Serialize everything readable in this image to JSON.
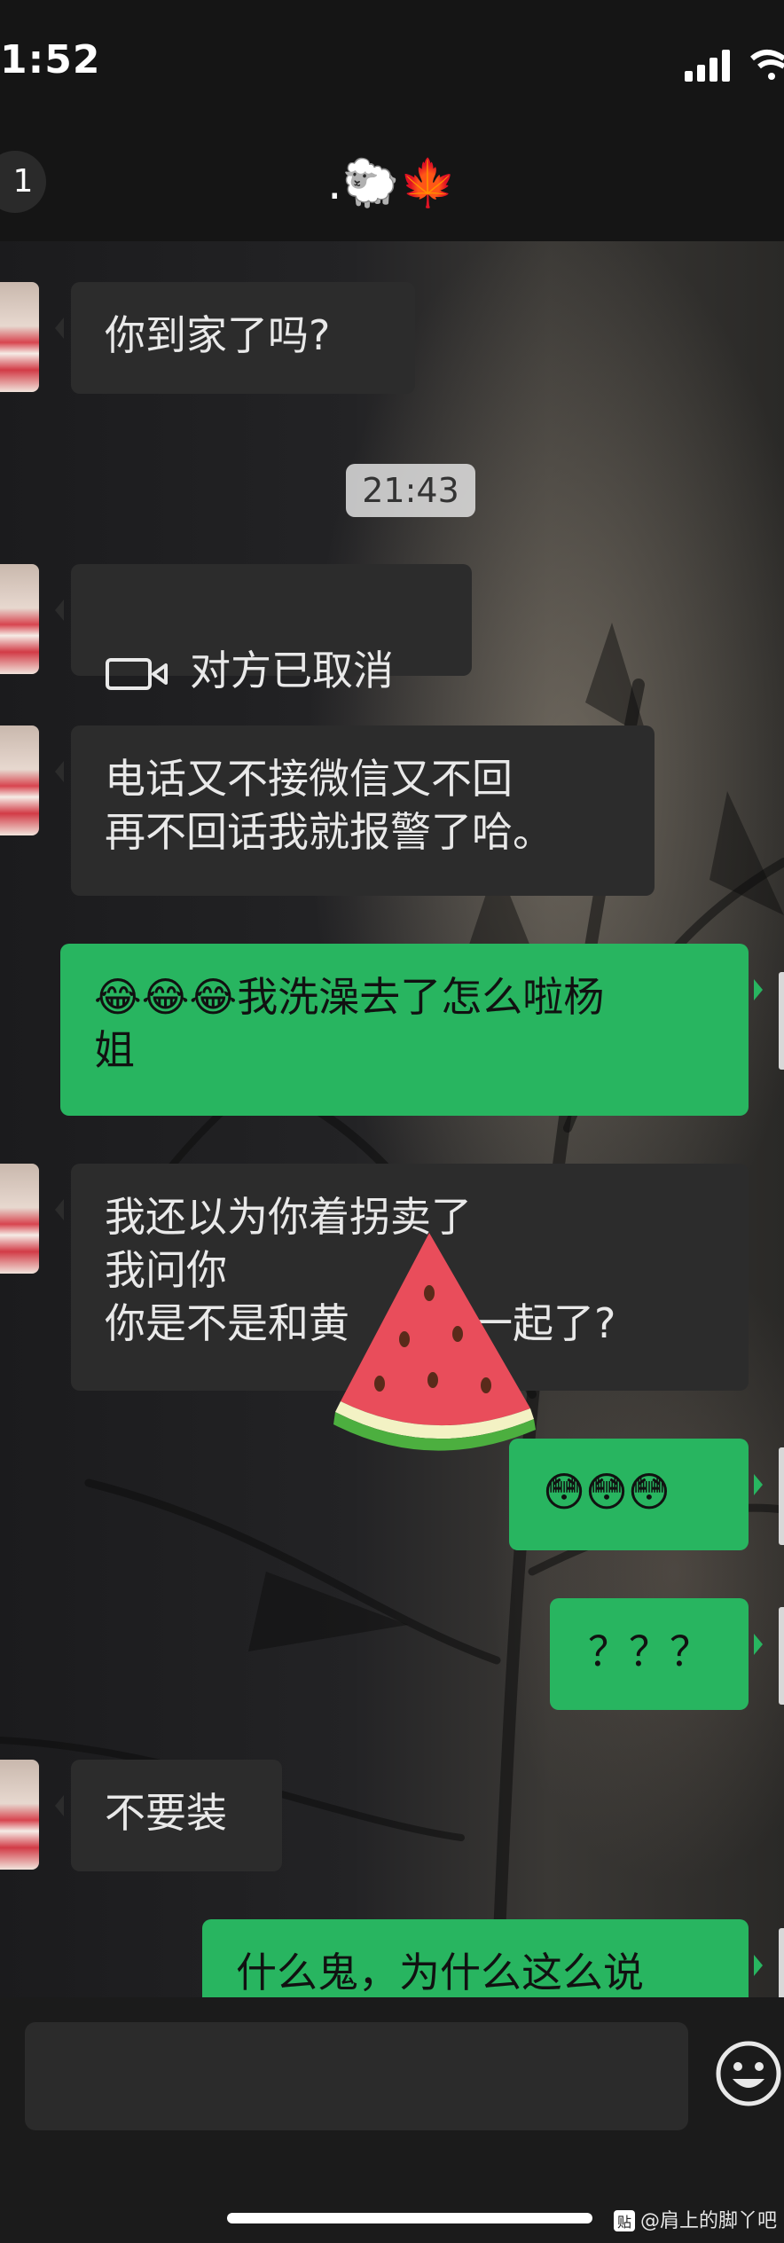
{
  "status_bar": {
    "time": "1:52"
  },
  "nav": {
    "unread_count": "1",
    "title": ".🐑🍁"
  },
  "messages": {
    "m1": {
      "sender": "other",
      "text": "你到家了吗?"
    },
    "timestamp": "21:43",
    "m2": {
      "sender": "other",
      "text": "对方已取消",
      "icon": "video-call-icon"
    },
    "m3": {
      "sender": "other",
      "text": "电话又不接微信又不回\n再不回话我就报警了哈。"
    },
    "m4": {
      "sender": "me",
      "text": "😂😂😂我洗澡去了怎么啦杨\n姐"
    },
    "m5": {
      "sender": "other",
      "text": "我还以为你着拐卖了\n我问你\n你是不是和黄　　在一起了?"
    },
    "m6": {
      "sender": "me",
      "text": "😳😳😳"
    },
    "m7": {
      "sender": "me",
      "text": "？？？"
    },
    "m8": {
      "sender": "other",
      "text": "不要装"
    },
    "m9": {
      "sender": "me",
      "text": "什么鬼，为什么这么说"
    }
  },
  "input": {
    "placeholder": ""
  },
  "watermark": {
    "badge": "贴",
    "text": "@肩上的脚丫吧"
  },
  "colors": {
    "outgoing_bubble": "#28b560",
    "incoming_bubble": "#2c2c2c",
    "bar_background": "#151515"
  },
  "overlay_sticker": "watermelon-slice"
}
